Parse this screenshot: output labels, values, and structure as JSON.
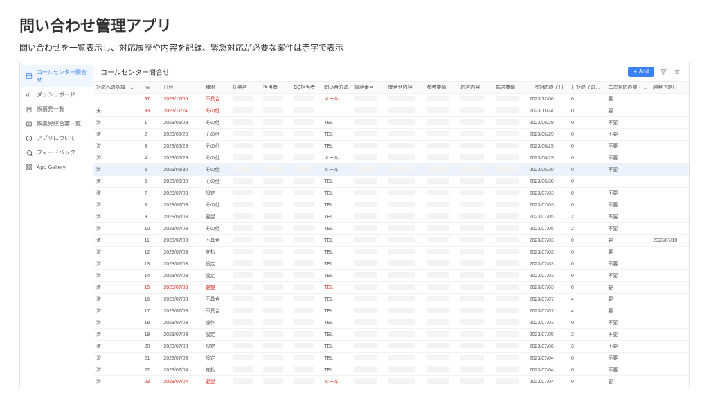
{
  "page": {
    "title": "問い合わせ管理アプリ",
    "subtitle": "問い合わせを一覧表示し、対応履歴や内容を記録、緊急対応が必要な案件は赤字で表示"
  },
  "sidebar": {
    "items": [
      {
        "label": "コールセンター問合せ",
        "icon": "list"
      },
      {
        "label": "ダッシュボード",
        "icon": "chart"
      },
      {
        "label": "帳票見一覧",
        "icon": "doc"
      },
      {
        "label": "帳票見絞合審一覧",
        "icon": "doc2"
      },
      {
        "label": "アプリについて",
        "icon": "info"
      },
      {
        "label": "フィードバック",
        "icon": "feedback"
      },
      {
        "label": "App Gallery",
        "icon": "grid"
      }
    ]
  },
  "main": {
    "title": "コールセンター問合せ",
    "add_label": "Add"
  },
  "columns": [
    "対応への認識（未…",
    "№",
    "日付",
    "種別",
    "氏名名",
    "担当者",
    "CC担当者",
    "問い合方法",
    "電話番号",
    "問合せ内容",
    "参考業績",
    "応答内容",
    "応答業績",
    "一次対応終了日",
    "日対終了の日数",
    "二次対応の要・不…",
    "純発予定日"
  ],
  "rows": [
    {
      "status": "",
      "no": "97",
      "date": "2023/12/05",
      "type": "不具合",
      "method": "メール",
      "done1": "2023/12/06",
      "diff": "0",
      "second": "要",
      "due": "",
      "urgent": true
    },
    {
      "status": "未",
      "no": "93",
      "date": "2023/11/24",
      "type": "その他",
      "method": "",
      "done1": "2023/11/24",
      "diff": "0",
      "second": "要",
      "due": "",
      "urgent": true
    },
    {
      "status": "済",
      "no": "1",
      "date": "2023/06/29",
      "type": "その他",
      "method": "TEL",
      "done1": "2023/06/29",
      "diff": "0",
      "second": "不要",
      "due": ""
    },
    {
      "status": "済",
      "no": "2",
      "date": "2023/06/29",
      "type": "その他",
      "method": "TEL",
      "done1": "2023/06/29",
      "diff": "0",
      "second": "不要",
      "due": ""
    },
    {
      "status": "済",
      "no": "3",
      "date": "2023/06/29",
      "type": "その他",
      "method": "TEL",
      "done1": "2023/06/29",
      "diff": "0",
      "second": "不要",
      "due": ""
    },
    {
      "status": "済",
      "no": "4",
      "date": "2023/06/29",
      "type": "その他",
      "method": "メール",
      "done1": "2023/06/29",
      "diff": "0",
      "second": "不要",
      "due": ""
    },
    {
      "status": "済",
      "no": "5",
      "date": "2023/06/30",
      "type": "その他",
      "method": "メール",
      "done1": "2023/06/30",
      "diff": "0",
      "second": "不要",
      "due": "",
      "highlight": true
    },
    {
      "status": "済",
      "no": "6",
      "date": "2023/06/30",
      "type": "その他",
      "method": "TEL",
      "done1": "2023/06/30",
      "diff": "0",
      "second": "",
      "due": ""
    },
    {
      "status": "済",
      "no": "7",
      "date": "2023/07/03",
      "type": "設定",
      "method": "TEL",
      "done1": "2023/07/03",
      "diff": "0",
      "second": "不要",
      "due": ""
    },
    {
      "status": "済",
      "no": "8",
      "date": "2023/07/03",
      "type": "その他",
      "method": "TEL",
      "done1": "2023/07/03",
      "diff": "0",
      "second": "不要",
      "due": ""
    },
    {
      "status": "済",
      "no": "9",
      "date": "2023/07/03",
      "type": "要望",
      "method": "TEL",
      "done1": "2023/07/05",
      "diff": "2",
      "second": "不要",
      "due": ""
    },
    {
      "status": "済",
      "no": "10",
      "date": "2023/07/03",
      "type": "その他",
      "method": "TEL",
      "done1": "2023/07/05",
      "diff": "2",
      "second": "不要",
      "due": ""
    },
    {
      "status": "済",
      "no": "11",
      "date": "2023/07/03",
      "type": "不具合",
      "method": "TEL",
      "done1": "2023/07/03",
      "diff": "0",
      "second": "要",
      "due": "2023/07/10"
    },
    {
      "status": "済",
      "no": "12",
      "date": "2023/07/03",
      "type": "支払",
      "method": "TEL",
      "done1": "2023/07/03",
      "diff": "0",
      "second": "要",
      "due": ""
    },
    {
      "status": "済",
      "no": "13",
      "date": "2023/07/03",
      "type": "設定",
      "method": "TEL",
      "done1": "2023/07/03",
      "diff": "0",
      "second": "不要",
      "due": ""
    },
    {
      "status": "済",
      "no": "14",
      "date": "2023/07/03",
      "type": "設定",
      "method": "TEL",
      "done1": "2023/07/03",
      "diff": "0",
      "second": "不要",
      "due": ""
    },
    {
      "status": "済",
      "no": "15",
      "date": "2023/07/03",
      "type": "要望",
      "method": "TEL",
      "done1": "2023/07/03",
      "diff": "0",
      "second": "要",
      "due": "",
      "urgent": true
    },
    {
      "status": "済",
      "no": "16",
      "date": "2023/07/03",
      "type": "不具合",
      "method": "TEL",
      "done1": "2023/07/07",
      "diff": "4",
      "second": "要",
      "due": ""
    },
    {
      "status": "済",
      "no": "17",
      "date": "2023/07/03",
      "type": "不具合",
      "method": "TEL",
      "done1": "2023/07/07",
      "diff": "4",
      "second": "要",
      "due": ""
    },
    {
      "status": "済",
      "no": "18",
      "date": "2023/07/03",
      "type": "操作",
      "method": "TEL",
      "done1": "2023/07/03",
      "diff": "0",
      "second": "不要",
      "due": ""
    },
    {
      "status": "済",
      "no": "19",
      "date": "2023/07/03",
      "type": "設定",
      "method": "TEL",
      "done1": "2023/07/05",
      "diff": "2",
      "second": "不要",
      "due": ""
    },
    {
      "status": "済",
      "no": "20",
      "date": "2023/07/03",
      "type": "設定",
      "method": "TEL",
      "done1": "2023/07/06",
      "diff": "3",
      "second": "不要",
      "due": ""
    },
    {
      "status": "済",
      "no": "21",
      "date": "2023/07/03",
      "type": "設定",
      "method": "TEL",
      "done1": "2023/07/04",
      "diff": "0",
      "second": "不要",
      "due": ""
    },
    {
      "status": "済",
      "no": "22",
      "date": "2023/07/04",
      "type": "支払",
      "method": "TEL",
      "done1": "2023/07/04",
      "diff": "0",
      "second": "不要",
      "due": ""
    },
    {
      "status": "済",
      "no": "23",
      "date": "2023/07/04",
      "type": "要望",
      "method": "メール",
      "done1": "2023/07/04",
      "diff": "0",
      "second": "要",
      "due": "",
      "urgent": true
    }
  ]
}
